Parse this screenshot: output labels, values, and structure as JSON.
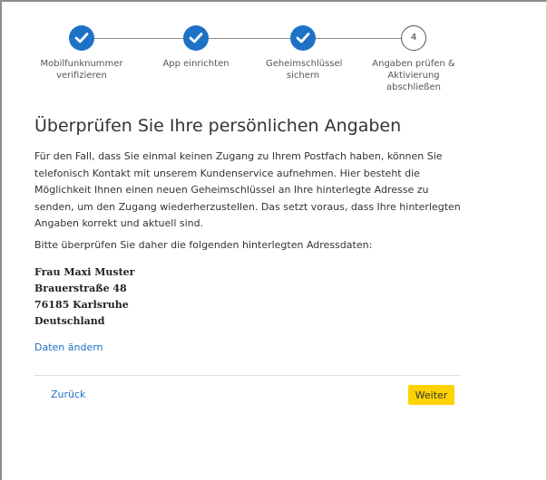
{
  "stepper": {
    "steps": [
      {
        "label": "Mobilfunknummer verifizieren",
        "state": "done"
      },
      {
        "label": "App einrichten",
        "state": "done"
      },
      {
        "label": "Geheimschlüssel sichern",
        "state": "done"
      },
      {
        "label": "Angaben prüfen & Aktivierung abschließen",
        "state": "current",
        "number": "4"
      }
    ]
  },
  "main": {
    "title": "Überprüfen Sie Ihre persönlichen Angaben",
    "intro": "Für den Fall, dass Sie einmal keinen Zugang zu Ihrem Postfach haben, können Sie telefonisch Kontakt mit unserem Kundenservice aufnehmen. Hier besteht die Möglichkeit Ihnen einen neuen Geheimschlüssel an Ihre hinterlegte Adresse zu senden, um den Zugang wiederherzustellen. Das setzt voraus, dass Ihre hinterlegten Angaben korrekt und aktuell sind.",
    "prompt": "Bitte überprüfen Sie daher die folgenden hinterlegten Adressdaten:",
    "address": {
      "name": "Frau Maxi Muster",
      "street": "Brauerstraße 48",
      "city": "76185 Karlsruhe",
      "country": "Deutschland"
    },
    "edit_link": "Daten ändern"
  },
  "footer": {
    "back_label": "Zurück",
    "next_label": "Weiter"
  },
  "colors": {
    "accent": "#1d72c5",
    "primary_button": "#ffd300"
  }
}
